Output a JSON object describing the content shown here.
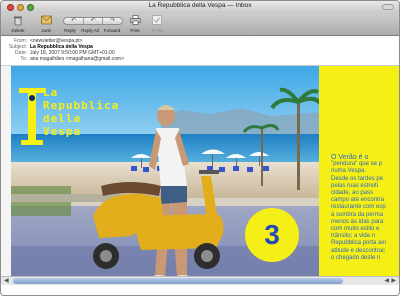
{
  "window": {
    "title": "La Repubblica della Vespa — Inbox"
  },
  "toolbar": {
    "delete": "Delete",
    "junk": "Junk",
    "reply": "Reply",
    "reply_all": "Reply All",
    "forward": "Forward",
    "print": "Print",
    "todo": "To Do"
  },
  "headers": {
    "from_label": "From:",
    "from": "<newsletter@vespa.pt>",
    "subject_label": "Subject:",
    "subject": "La Repubblica della Vespa",
    "date_label": "Date:",
    "date": "July 18, 2007 9:50:00 PM GMT+01:00",
    "to_label": "To:",
    "to": "ana magalhães <magalhana@gmail.com>"
  },
  "newsletter": {
    "logo_line1": "La",
    "logo_line2": "Repubblica",
    "logo_line3": "della",
    "logo_line4": "Vespa",
    "issue_number": "3",
    "article_lines": [
      "O Verão é o",
      "\"pendura\" que se p",
      "numa Vespa.",
      "Desde os tardes pe",
      "pelas ruas estreiti",
      "cidade, ao pass",
      "campo até encontra",
      "restaurante com esp",
      "à sombra da perma",
      "menos às idas para",
      "com muito estilo e",
      "trânsito; a vida n",
      "Repubblica porta ain",
      "atitude e descontrac",
      "o chegado deste n"
    ]
  },
  "colors": {
    "accent_yellow": "#f6ef16",
    "accent_blue": "#2149b7",
    "article_blue": "#2b68c4"
  }
}
